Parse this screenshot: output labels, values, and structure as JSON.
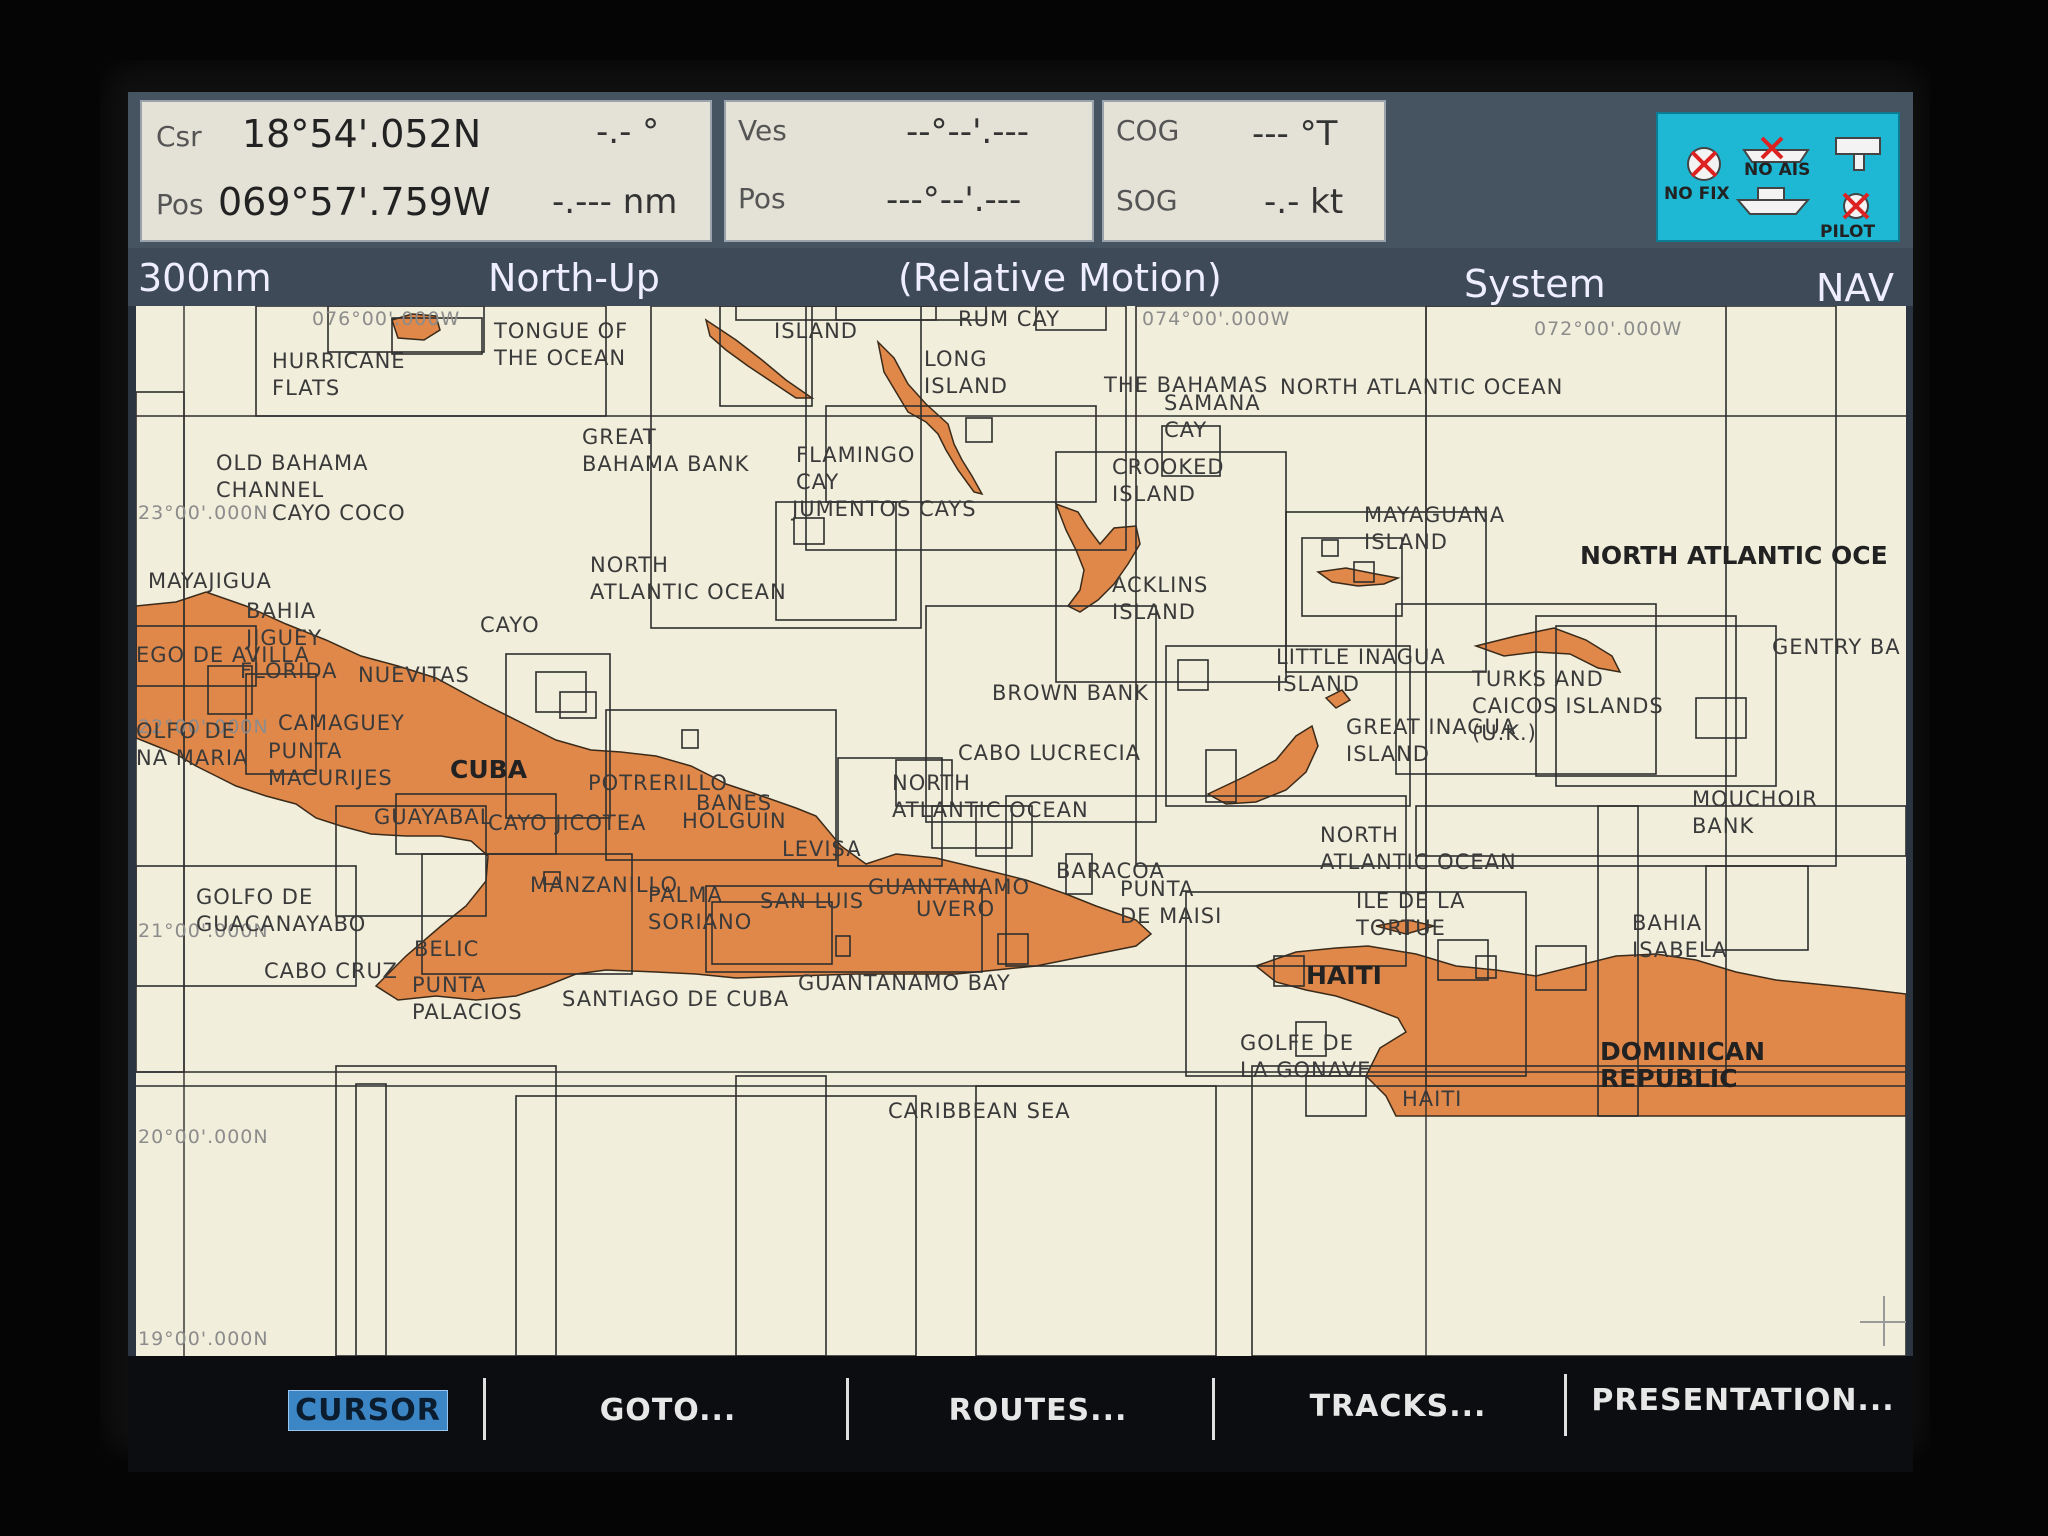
{
  "databar": {
    "csr_label": "Csr",
    "csr_lat": "18°54'.052N",
    "csr_bearing": "-.- °",
    "pos_label": "Pos",
    "pos_lon": "069°57'.759W",
    "pos_range": "-.--- nm",
    "ves_label": "Ves",
    "ves_lat": "--°--'.---",
    "ves_pos_label": "Pos",
    "ves_lon": "---°--'.---",
    "cog_label": "COG",
    "cog_value": "--- °T",
    "sog_label": "SOG",
    "sog_value": "-.- kt"
  },
  "status_icons": {
    "no_fix": "NO FIX",
    "no_ais": "NO AIS",
    "pilot": "PILOT"
  },
  "header": {
    "range": "300nm",
    "orientation": "North-Up",
    "motion": "(Relative Motion)",
    "system": "System",
    "mode": "NAV"
  },
  "map_labels": {
    "tongue_of_ocean": "TONGUE OF\nTHE OCEAN",
    "rum_cay": "RUM CAY",
    "island_top": "ISLAND",
    "long_island": "LONG\nISLAND",
    "hurricane_flats": "HURRICANE\nFLATS",
    "the_bahamas": "THE BAHAMAS",
    "north_atlantic_top": "NORTH ATLANTIC OCEAN",
    "samana_cay": "SAMANA\nCAY",
    "great_bahama_bank": "GREAT\nBAHAMA BANK",
    "flamingo_cay": "FLAMINGO\nCAY",
    "crooked_island": "CROOKED\nISLAND",
    "old_bahama_channel": "OLD BAHAMA\nCHANNEL",
    "cayo_coco": "CAYO COCO",
    "jumentos_cays": "JUMENTOS CAYS",
    "mayaguana_island": "MAYAGUANA\nISLAND",
    "north_atlantic_mid": "NORTH\nATLANTIC OCEAN",
    "acklins_island": "ACKLINS\nISLAND",
    "north_atlantic_oce": "NORTH ATLANTIC OCE",
    "mayajigua": "MAYAJIGUA",
    "bahia_jiguey": "BAHIA\nJIGUEY",
    "cayo": "CAYO",
    "ego_de_avilla": "EGO DE AVILLA",
    "florida": "FLORIDA",
    "nuevitas": "NUEVITAS",
    "little_inagua": "LITTLE INAGUA\nISLAND",
    "turks_caicos": "TURKS AND\nCAICOS ISLANDS\n(U.K.)",
    "gentry_ba": "GENTRY BA",
    "brown_bank": "BROWN BANK",
    "camaguey": "CAMAGUEY",
    "golfo_de_ana_maria": "OLFO DE\nNA MARIA",
    "punta_macurijes": "PUNTA\nMACURIJES",
    "great_inagua": "GREAT INAGUA\nISLAND",
    "cabo_lucrecia": "CABO LUCRECIA",
    "cuba": "CUBA",
    "potrerillo": "POTRERILLO",
    "banes": "BANES",
    "holguin": "HOLGUIN",
    "north_atlantic_lower": "NORTH\nATLANTIC OCEAN",
    "mouchoir_bank": "MOUCHOIR\nBANK",
    "guayabal": "GUAYABAL",
    "cayo_jicotea": "CAYO JICOTEA",
    "levisa": "LEVISA",
    "north_atlantic_haiti": "NORTH\nATLANTIC OCEAN",
    "baracoa": "BARACOA",
    "punta_de_maisi": "PUNTA\nDE MAISI",
    "golfo_de_guacanayabo": "GOLFO DE\nGUACANAYABO",
    "manzanillo": "MANZANILLO",
    "palma_soriano": "PALMA\nSORIANO",
    "san_luis": "SAN LUIS",
    "guantanamo": "GUANTANAMO",
    "uvero": "UVERO",
    "ile_de_la_tortue": "ILE DE LA\nTORTUE",
    "bahia_isabela": "BAHIA\nISABELA",
    "cabo_cruz": "CABO CRUZ",
    "belic": "BELIC",
    "punta_palacios": "PUNTA\nPALACIOS",
    "santiago_de_cuba": "SANTIAGO DE CUBA",
    "guantanamo_bay": "GUANTANAMO BAY",
    "haiti": "HAITI",
    "golfe_de_la_gonave": "GOLFE DE\nLA GONAVE",
    "dominican_republic": "DOMINICAN\nREPUBLIC",
    "haiti_small": "HAITI",
    "caribbean_sea": "CARIBBEAN SEA"
  },
  "coord_labels": {
    "lon_076": "076°00'.000W",
    "lon_074": "074°00'.000W",
    "lon_072": "072°00'.000W",
    "lat_23": "23°00'.000N",
    "lat_22": "22°00'.000N",
    "lat_21": "21°00'.000N",
    "lat_20": "20°00'.000N",
    "lat_19": "19°00'.000N"
  },
  "softkeys": {
    "cursor": "CURSOR",
    "goto": "GOTO...",
    "routes": "ROUTES...",
    "tracks": "TRACKS...",
    "presentation": "PRESENTATION..."
  },
  "colors": {
    "land": "#e0884a",
    "sea": "#f1eedb",
    "grid": "#2e2e2e",
    "status_bg": "#1fb8d4",
    "cursor_key": "#3c86c6"
  }
}
